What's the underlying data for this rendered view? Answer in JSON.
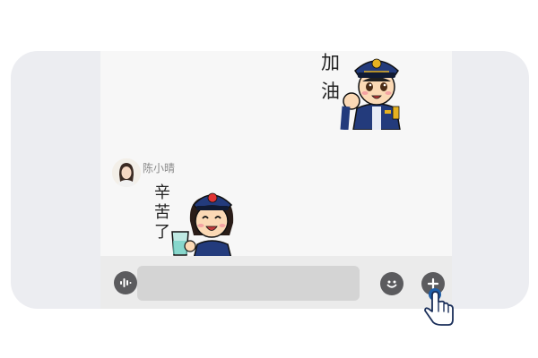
{
  "conversation": {
    "messages": [
      {
        "type": "sticker",
        "sender": "self",
        "sticker_name": "police-officer-cheer-sticker",
        "caption": "加油"
      },
      {
        "type": "sticker",
        "sender": "陈小晴",
        "sticker_name": "police-officer-water-sticker",
        "caption": "辛苦了"
      }
    ]
  },
  "toolbar": {
    "voice_icon": "voice-wave-icon",
    "input_value": "",
    "emoji_icon": "smiley-face-icon",
    "add_icon": "plus-icon"
  },
  "colors": {
    "frame_bg": "#ecedf1",
    "chat_bg": "#f7f7f7",
    "toolbar_bg": "#ebebeb",
    "input_bg": "#d4d4d4",
    "icon_fill": "#5b5b5e",
    "cursor_blue": "#1f5fa8"
  }
}
